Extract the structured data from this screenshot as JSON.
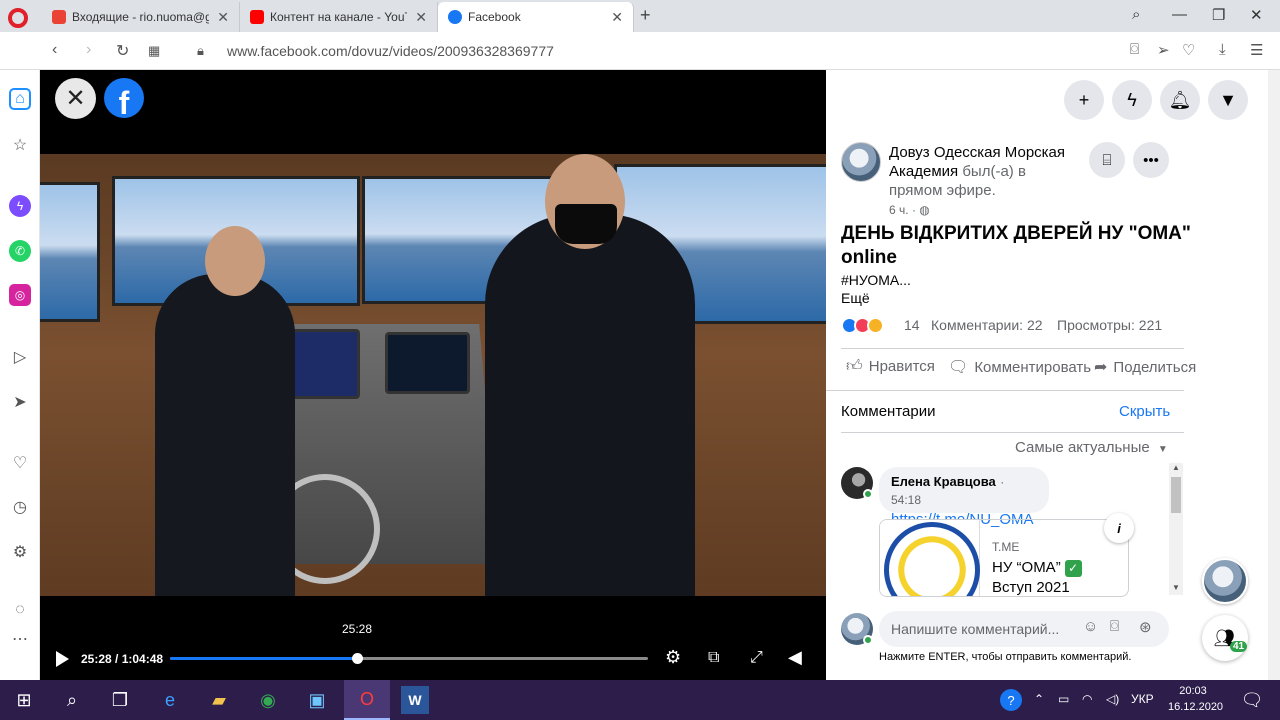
{
  "browser": {
    "tabs": [
      {
        "title": "Входящие - rio.nuoma@gr",
        "favicon_color": "#ea4335"
      },
      {
        "title": "Контент на канале - YouTu",
        "favicon_color": "#ff0000"
      },
      {
        "title": "Facebook",
        "favicon_color": "#1877f2"
      }
    ],
    "url": "www.facebook.com/dovuz/videos/200936328369777"
  },
  "video": {
    "hover_time": "25:28",
    "timecode": "25:28 / 1:04:48",
    "progress_fraction": 0.391
  },
  "post": {
    "page_name": "Довуз Одесская Морская Академия",
    "status": "был(-а) в прямом эфире.",
    "time_ago": "6 ч.",
    "title": "ДЕНЬ ВІДКРИТИХ ДВЕРЕЙ НУ \"ОМА\" online",
    "hashtag": "#НУОМА...",
    "more": "Ещё",
    "reaction_count": "14",
    "comment_count": "Комментарии: 22",
    "views": "Просмотры: 221",
    "actions": {
      "like": "Нравится",
      "comment": "Комментировать",
      "share": "Поделиться"
    }
  },
  "comments": {
    "header": "Комментарии",
    "hide": "Скрыть",
    "sort": "Самые актуальные",
    "items": [
      {
        "author": "Елена Кравцова",
        "time": "54:18",
        "link": "https://t.me/NU_OMA",
        "card_source": "T.ME",
        "card_title": "НУ “ОМА”",
        "card_subtitle": "Вступ 2021"
      }
    ],
    "composer_placeholder": "Напишите комментарий...",
    "enter_hint": "Нажмите ENTER, чтобы отправить комментарий."
  },
  "contacts_badge": "41",
  "taskbar": {
    "lang": "УКР",
    "time": "20:03",
    "date": "16.12.2020"
  }
}
